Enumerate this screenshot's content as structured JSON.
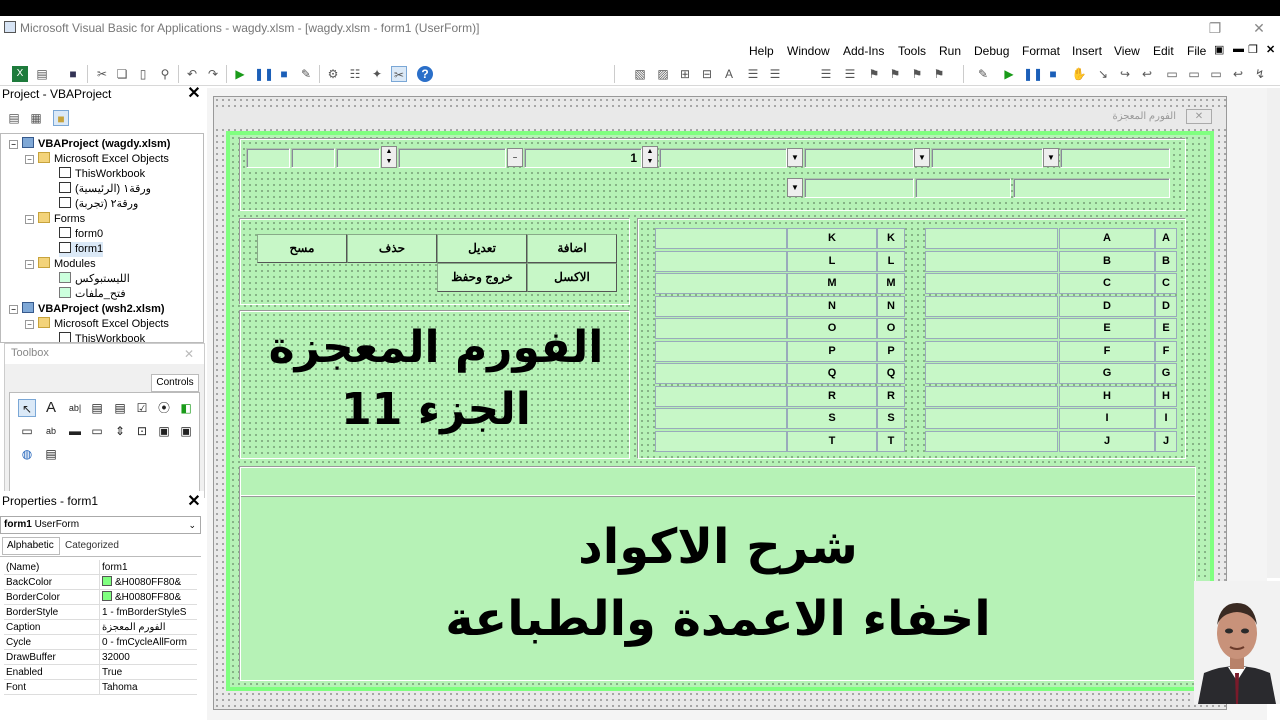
{
  "window": {
    "title": "Microsoft Visual Basic for Applications - wagdy.xlsm - [wagdy.xlsm - form1 (UserForm)]"
  },
  "menu": {
    "items": [
      "Help",
      "Window",
      "Add-Ins",
      "Tools",
      "Run",
      "Debug",
      "Format",
      "Insert",
      "View",
      "Edit",
      "File"
    ]
  },
  "project": {
    "title": "Project - VBAProject",
    "tree": [
      "VBAProject (wagdy.xlsm)",
      "Microsoft Excel Objects",
      "ThisWorkbook",
      "ورقة١ (الرئيسية)",
      "ورقة٢ (تجربة)",
      "Forms",
      "form0",
      "form1",
      "Modules",
      "الليستبوكس",
      "فتح_ملفات",
      "VBAProject (wsh2.xlsm)",
      "Microsoft Excel Objects",
      "ThisWorkbook"
    ]
  },
  "toolbox": {
    "title": "Toolbox",
    "tab": "Controls"
  },
  "properties": {
    "title": "Properties - form1",
    "object_name": "form1",
    "object_type": "UserForm",
    "tabs": [
      "Alphabetic",
      "Categorized"
    ],
    "rows": [
      {
        "name": "(Name)",
        "value": "form1"
      },
      {
        "name": "BackColor",
        "value": "&H0080FF80&"
      },
      {
        "name": "BorderColor",
        "value": "&H0080FF80&"
      },
      {
        "name": "BorderStyle",
        "value": "1 - fmBorderStyleS"
      },
      {
        "name": "Caption",
        "value": "الفورم المعجزة"
      },
      {
        "name": "Cycle",
        "value": "0 - fmCycleAllForm"
      },
      {
        "name": "DrawBuffer",
        "value": "32000"
      },
      {
        "name": "Enabled",
        "value": "True"
      },
      {
        "name": "Font",
        "value": "Tahoma"
      }
    ]
  },
  "form": {
    "caption": "الفورم المعجزة",
    "spin_value": "1",
    "buttons": {
      "add": "اضافة",
      "edit": "تعديل",
      "delete": "حذف",
      "clear": "مسح",
      "excel": "الاكسل",
      "exit_save": "خروج وحفظ"
    },
    "overlay_title_line1": "الفورم المعجزة",
    "overlay_title_line2": "الجزء 11",
    "overlay_sub_line1": "شرح الاكواد",
    "overlay_sub_line2": "اخفاء الاعمدة والطباعة",
    "grid_right_labels": [
      "A",
      "B",
      "C",
      "D",
      "E",
      "F",
      "G",
      "H",
      "I",
      "J"
    ],
    "grid_left_labels": [
      "K",
      "L",
      "M",
      "N",
      "O",
      "P",
      "Q",
      "R",
      "S",
      "T"
    ]
  },
  "colors": {
    "form_green": "#80FF80",
    "field_green": "#C7F7C7"
  }
}
